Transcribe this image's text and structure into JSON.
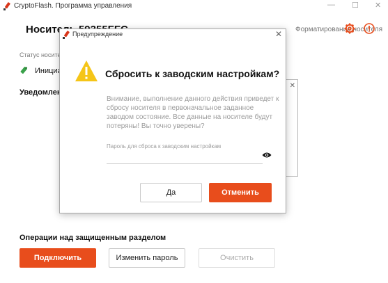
{
  "window": {
    "title": "CryptoFlash. Программа управления",
    "minimize": "—",
    "maximize": "☐",
    "close": "✕"
  },
  "header": {
    "carrier_title": "Носитель 59355FFC",
    "carrier_link": "Форматирование носителя"
  },
  "status": {
    "label": "Статус носителя",
    "value": "Инициализирован"
  },
  "notifications": {
    "title": "Уведомления"
  },
  "operations": {
    "title": "Операции над защищенным разделом",
    "connect": "Подключить",
    "change_password": "Изменить пароль",
    "clear": "Очистить"
  },
  "dialog": {
    "title": "Предупреждение",
    "heading": "Сбросить к заводским настройкам?",
    "body": "Внимание, выполнение данного действия приведет к сбросу носителя в первоначальное заданное заводом состояние. Все данные на носителе будут потеряны! Вы точно уверены?",
    "password_label": "Пароль для сброса к заводским настройкам",
    "password_value": "",
    "yes": "Да",
    "cancel": "Отменить"
  },
  "colors": {
    "accent": "#e84d1c",
    "warning": "#f5c518",
    "muted_text": "#9b9b9b"
  },
  "icons": {
    "app": "usb-pen-icon",
    "settings": "gear-icon",
    "info": "info-icon",
    "usb": "usb-drive-icon",
    "warning": "warning-triangle-icon",
    "show_password": "eye-icon"
  }
}
